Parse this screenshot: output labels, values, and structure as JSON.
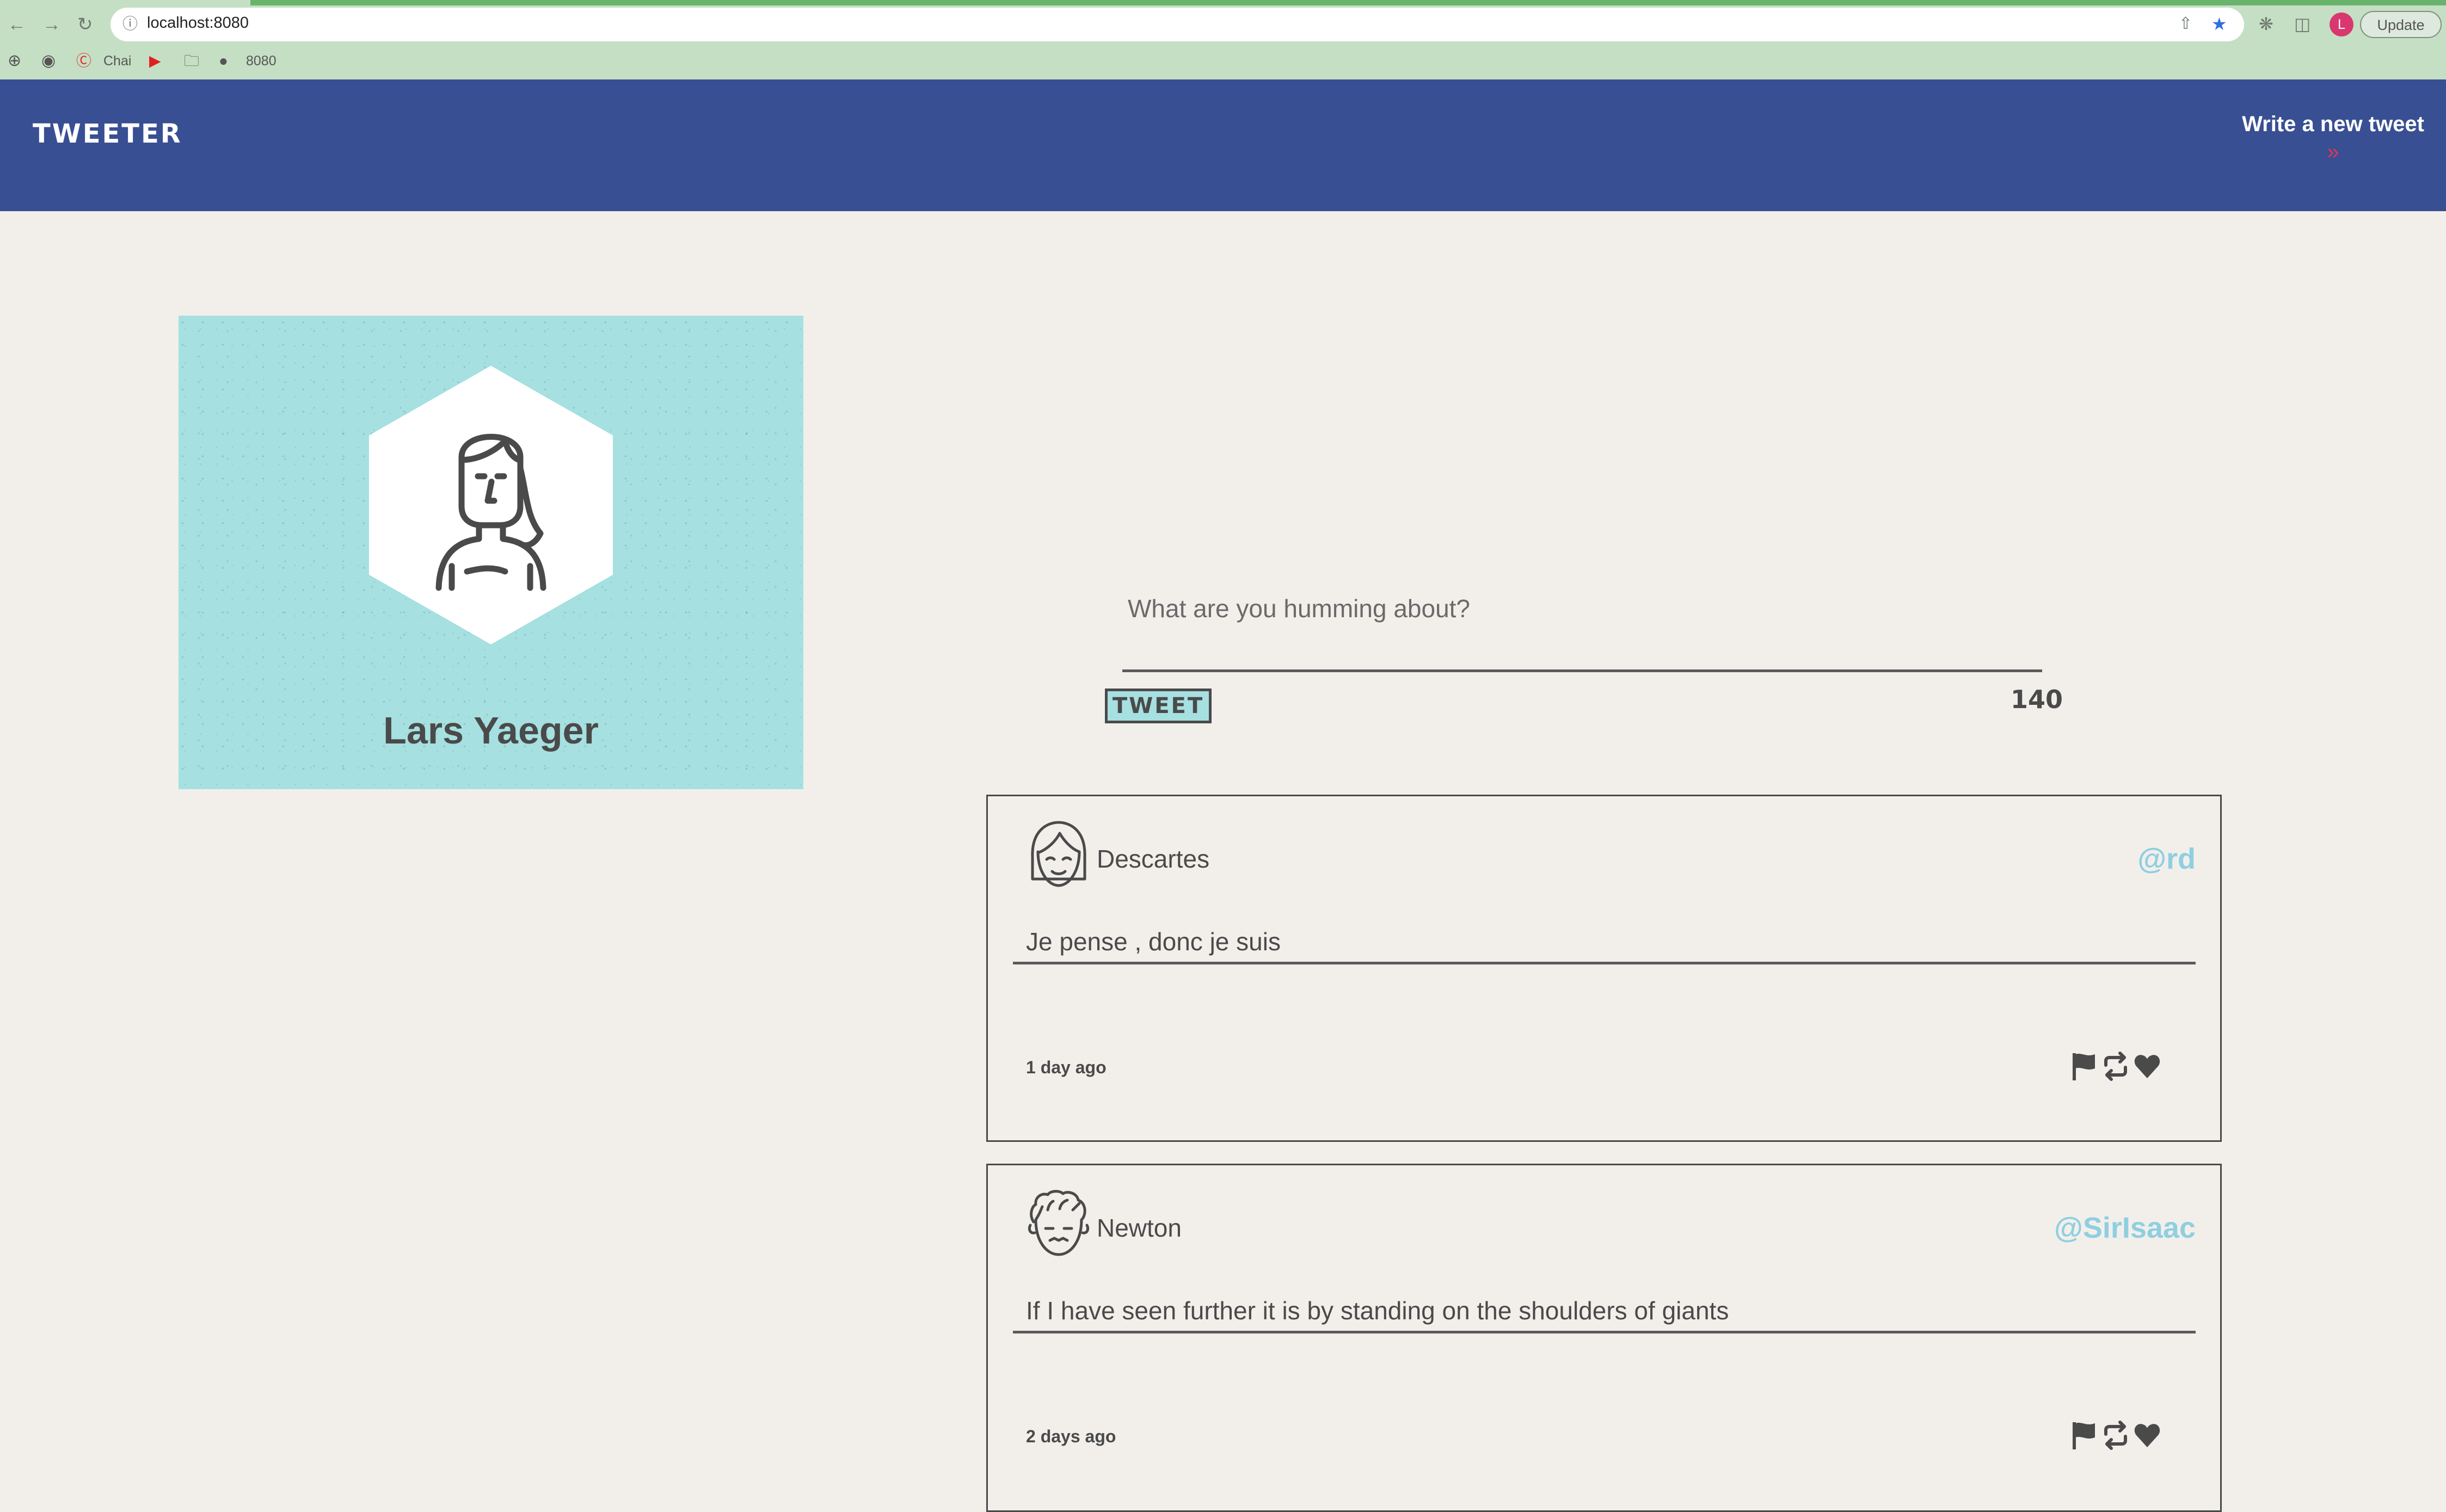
{
  "browser": {
    "url": "localhost:8080",
    "bookmarks": [
      "Chai",
      "8080"
    ],
    "update_label": "Update",
    "profile_initial": "L"
  },
  "nav": {
    "brand": "TWEETER",
    "write_tweet_label": "Write a new tweet"
  },
  "profile": {
    "name": "Lars Yaeger"
  },
  "compose": {
    "placeholder": "What are you humming about?",
    "button_label": "TWEET",
    "char_counter": "140"
  },
  "tweets": [
    {
      "name": "Descartes",
      "handle": "@rd",
      "content": "Je pense , donc je suis",
      "time": "1 day ago"
    },
    {
      "name": "Newton",
      "handle": "@SirIsaac",
      "content": "If I have seen further it is by standing on the shoulders of giants",
      "time": "2 days ago"
    }
  ],
  "colors": {
    "nav": "#384f93",
    "accent": "#a6e0e1",
    "handle": "#8fcfe0",
    "chevron": "#e1345a",
    "background": "#f2efeb"
  },
  "icons": [
    "back-icon",
    "forward-icon",
    "reload-icon",
    "site-info-icon",
    "share-icon",
    "star-icon",
    "extensions-icon",
    "sidebar-icon",
    "menu-icon",
    "flag-icon",
    "retweet-icon",
    "heart-icon"
  ]
}
